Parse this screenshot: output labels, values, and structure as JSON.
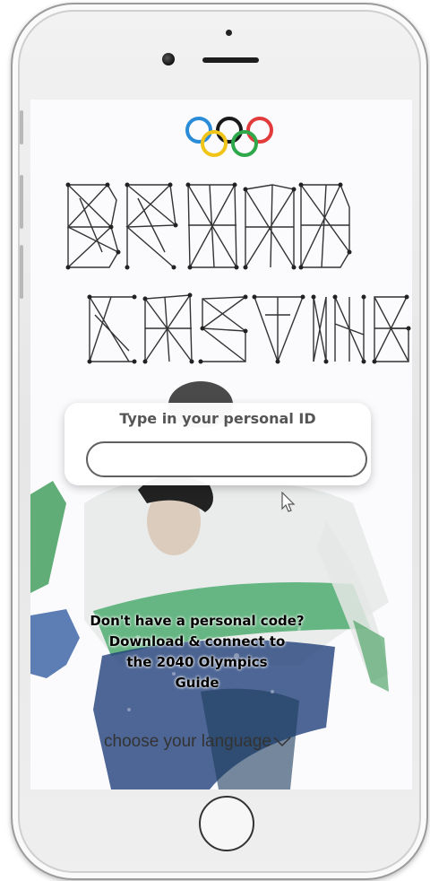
{
  "login": {
    "id_prompt": "Type in your personal ID",
    "id_value": "",
    "download_line1": "Don't have a personal code?",
    "download_line2": "Download & connect to",
    "download_line3": "the 2040 Olympics",
    "download_line4": "Guide",
    "language_label": "choose your language"
  },
  "branding": {
    "logo": "olympic-rings",
    "title_word_1": "BROAD",
    "title_word_2": "CASTING",
    "ring_colors": [
      "#2a8bd8",
      "#f0c419",
      "#1a1a1a",
      "#2ea84a",
      "#e23b3b"
    ]
  },
  "icons": {
    "cursor": "mouse-pointer-icon",
    "language_chevron": "chevron-down-icon"
  }
}
